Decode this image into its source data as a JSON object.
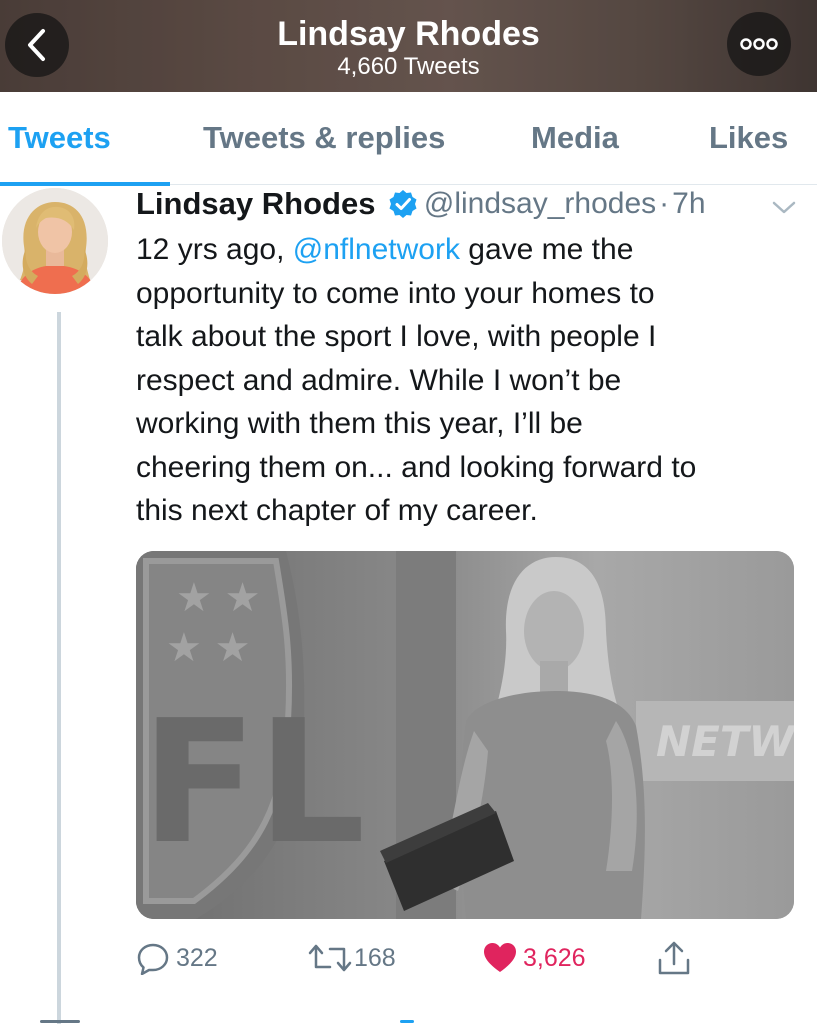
{
  "header": {
    "title": "Lindsay Rhodes",
    "subtitle": "4,660 Tweets",
    "back_icon": "chevron-left-icon",
    "more_icon": "more-options-icon"
  },
  "tabs": [
    {
      "label": "Tweets",
      "active": true
    },
    {
      "label": "Tweets & replies",
      "active": false
    },
    {
      "label": "Media",
      "active": false
    },
    {
      "label": "Likes",
      "active": false
    }
  ],
  "tweet": {
    "author_name": "Lindsay Rhodes",
    "handle": "@lindsay_rhodes",
    "separator": "·",
    "time": "7h",
    "text_lines": [
      {
        "before": "12 yrs ago, ",
        "mention": "@nflnetwork",
        "after": " gave me the"
      },
      "opportunity to come into your homes to",
      "talk about the sport I love, with people I",
      "respect and admire.  While I won’t be",
      "working with them this year, I’ll be",
      "cheering them on... and looking forward to",
      "this next chapter of my career."
    ],
    "media_caption": "NETW",
    "media_logo_letters": "FL",
    "actions": {
      "replies": "322",
      "retweets": "168",
      "likes": "3,626"
    }
  },
  "colors": {
    "accent": "#1da1f2",
    "secondary_text": "#657786",
    "like": "#e0245e",
    "divider": "#e1e8ed"
  }
}
